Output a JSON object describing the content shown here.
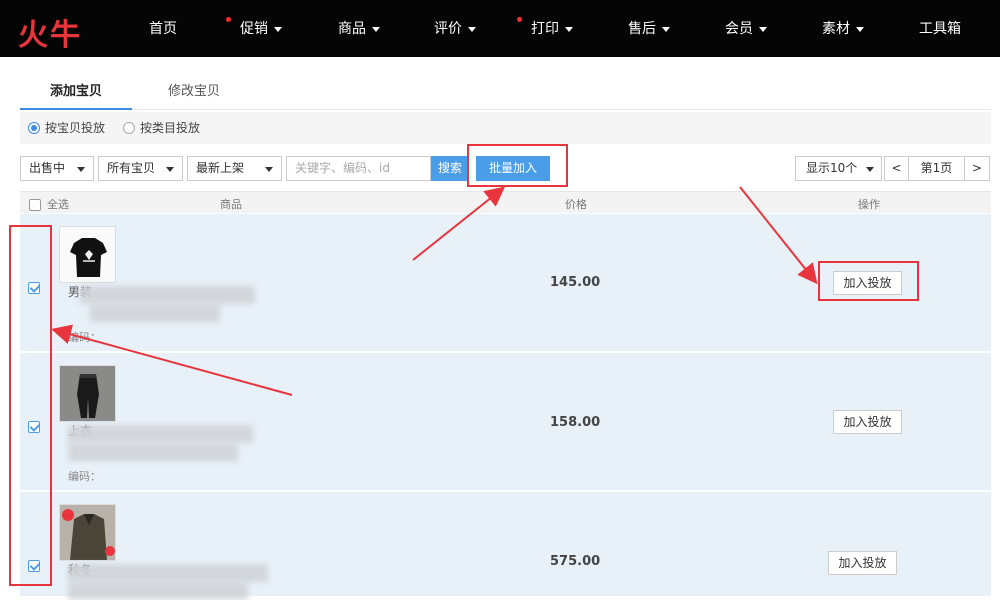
{
  "brand": {
    "logo_text": "火牛",
    "accent": "#e8343d"
  },
  "nav": [
    {
      "label": "首页",
      "caret": false,
      "dot": false
    },
    {
      "label": "促销",
      "caret": true,
      "dot": true
    },
    {
      "label": "商品",
      "caret": true,
      "dot": false
    },
    {
      "label": "评价",
      "caret": true,
      "dot": false
    },
    {
      "label": "打印",
      "caret": true,
      "dot": true
    },
    {
      "label": "售后",
      "caret": true,
      "dot": false
    },
    {
      "label": "会员",
      "caret": true,
      "dot": false
    },
    {
      "label": "素材",
      "caret": true,
      "dot": false
    },
    {
      "label": "工具箱",
      "caret": false,
      "dot": false
    }
  ],
  "tabs": {
    "add": "添加宝贝",
    "modify": "修改宝贝"
  },
  "radios": {
    "by_item": "按宝贝投放",
    "by_category": "按类目投放"
  },
  "filters": {
    "status": "出售中",
    "scope": "所有宝贝",
    "sort": "最新上架",
    "search_placeholder": "关键字、编码、id",
    "search_btn": "搜索",
    "batch_btn": "批量加入"
  },
  "pager": {
    "page_size": "显示10个",
    "prev": "<",
    "page": "第1页",
    "next": ">"
  },
  "table": {
    "select_all": "全选",
    "col_item": "商品",
    "col_price": "价格",
    "col_action": "操作"
  },
  "rows": [
    {
      "title": "男装",
      "code": "编码：",
      "price": "145.00",
      "action": "加入投放",
      "checked": true
    },
    {
      "title": "上衣",
      "code": "编码：",
      "price": "158.00",
      "action": "加入投放",
      "checked": true
    },
    {
      "title": "秋冬",
      "code": "",
      "price": "575.00",
      "action": "加入投放",
      "checked": true
    }
  ]
}
